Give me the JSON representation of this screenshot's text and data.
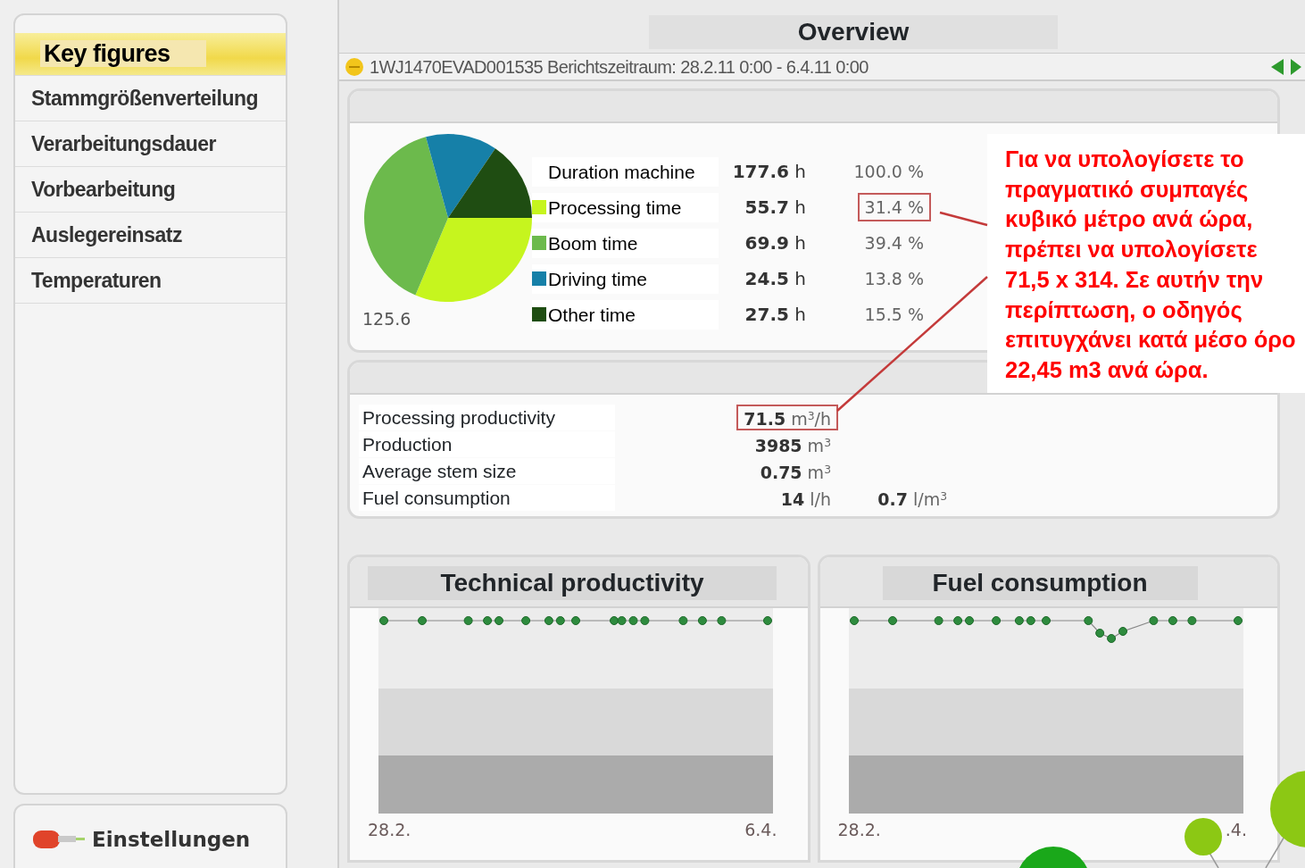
{
  "sidebar": {
    "items": [
      {
        "label": "Key figures",
        "selected": true
      },
      {
        "label": "Stammgrößenverteilung",
        "selected": false
      },
      {
        "label": "Verarbeitungsdauer",
        "selected": false
      },
      {
        "label": "Vorbearbeitung",
        "selected": false
      },
      {
        "label": "Auslegereinsatz",
        "selected": false
      },
      {
        "label": "Temperaturen",
        "selected": false
      }
    ],
    "settings": {
      "label": "Einstellungen"
    }
  },
  "page_title": "Overview",
  "info_bar": {
    "text": "1WJ1470EVAD001535 Berichtszeitraum: 28.2.11 0:00 - 6.4.11 0:00"
  },
  "times": {
    "pie_label": "125.6",
    "chart_data": {
      "type": "pie",
      "values": [
        31.4,
        39.4,
        13.8,
        15.5
      ]
    },
    "rows": [
      {
        "label": "Duration machine",
        "value": "177.6",
        "unit": "h",
        "percent": "100.0 %",
        "highlighted": false
      },
      {
        "label": "Processing time",
        "value": "55.7",
        "unit": "h",
        "percent": "31.4 %",
        "color": "#c6f51e",
        "highlighted": true
      },
      {
        "label": "Boom time",
        "value": "69.9",
        "unit": "h",
        "percent": "39.4 %",
        "color": "#6cba4c",
        "highlighted": false
      },
      {
        "label": "Driving time",
        "value": "24.5",
        "unit": "h",
        "percent": "13.8 %",
        "color": "#1680a8",
        "highlighted": false
      },
      {
        "label": "Other time",
        "value": "27.5",
        "unit": "h",
        "percent": "15.5 %",
        "color": "#1f4d12",
        "highlighted": false
      }
    ]
  },
  "productivity": {
    "rows": [
      {
        "label": "Processing productivity",
        "value": "71.5",
        "unit": "m$^{3}$/h",
        "highlighted": true
      },
      {
        "label": "Production",
        "value": "3985",
        "unit": "m$^{3}$",
        "highlighted": false
      },
      {
        "label": "Average stem size",
        "value": "0.75",
        "unit": "m$^{3}$",
        "highlighted": false
      },
      {
        "label": "Fuel consumption",
        "value": "14",
        "unit": "l/h",
        "extra_value": "0.7",
        "extra_unit": "l/m$^{3}$",
        "highlighted": false
      }
    ]
  },
  "charts": [
    {
      "title": "Technical productivity",
      "x_start": "28.2.",
      "x_end": "6.4."
    },
    {
      "title": "Fuel consumption",
      "x_start": "28.2.",
      "x_end": ".4."
    }
  ],
  "callout": {
    "text": "Για να υπολογίσετε το πραγματικό συμπαγές κυβικό μέτρο ανά ώρα, πρέπει να υπολογίσετε 71,5 x 314. Σε αυτήν την περίπτωση, ο οδηγός επιτυγχάνει κατά μέσο όρο 22,45 m3 ανά ώρα."
  }
}
